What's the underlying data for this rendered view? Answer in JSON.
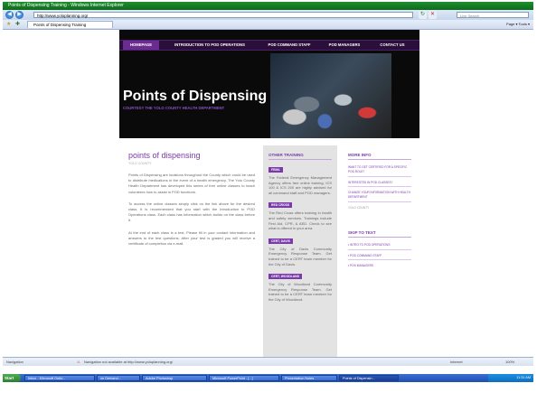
{
  "browser": {
    "title": "Points of Dispensing Training - Windows Internet Explorer",
    "address": "http://www.yoloplanning.org/",
    "search_placeholder": "Live Search",
    "tab_label": "Points of Dispensing Training",
    "toolbar_right": "Page ▾  Tools ▾"
  },
  "site": {
    "nav": [
      "HOMEPAGE",
      "INTRODUCTION TO POD OPERATIONS",
      "POD COMMAND STAFF",
      "POD MANAGERS",
      "CONTACT US"
    ],
    "title": "Points of Dispensing",
    "subtitle": "COURTESY THE YOLO COUNTY HEALTH DEPARTMENT"
  },
  "main": {
    "heading": "points of dispensing",
    "meta": "YOLO COUNTY",
    "paragraphs": [
      "Points of Dispensing are locations throughout the County which could be used to distribute medications in the event of a health emergency. The Yolo County Health Department has developed this series of free online classes to teach volunteers how to assist in POD functions.",
      "To access the online classes simply click on the link above for the desired class. It is recommended that you start with the Introduction to POD Operations class. Each class has information which builds on the class before it.",
      "At the end of each class is a test. Please fill in your contact information and answers to the test questions. After your test is graded you will receive a certificate of completion via e-mail."
    ]
  },
  "other_training": {
    "heading": "OTHER TRAINING",
    "items": [
      {
        "tag": "FEMA",
        "text": "The Federal Emergency Management Agency offers free online training. ICS 100 & ICS 200 are highly advised for all command staff and POD managers."
      },
      {
        "tag": "RED CROSS",
        "text": "The Red Cross offers training in health and safety services. Trainings include First Aid, CPR, & AED. Check to see what is offered in your area."
      },
      {
        "tag": "CERT, DAVIS",
        "text": "The City of Davis Community Emergency Response Team. Get trained to be a CERT team member for the City of Davis."
      },
      {
        "tag": "CERT, WOODLAND",
        "text": "The City of Woodland Community Emergency Response Team. Get trained to be a CERT team member for the City of Woodland."
      }
    ]
  },
  "more_info": {
    "heading": "MORE INFO",
    "items": [
      "WANT TO GET CERTIFIED FOR A SPECIFIC POD ROLE?",
      "INTERESTED IN POD CLASSES?",
      "CHANGE YOUR INFORMATION WITH HEALTH DEPARTMENT",
      "YOLO COUNTY"
    ]
  },
  "skip_to_text": {
    "heading": "SKIP TO TEXT",
    "items": [
      "INTRO TO POD OPERATIONS",
      "POD COMMAND STAFF",
      "POD MANAGERS"
    ]
  },
  "status": {
    "left": "Navigation",
    "message": "Navigation not available at http://www.yoloplanning.org/",
    "zone": "Internet",
    "zoom": "100%"
  },
  "taskbar": {
    "start": "Start",
    "buttons": [
      "Inbox - Microsoft Outlo...",
      "on Demand...",
      "Adobe Photoshop",
      "Microsoft PowerPoint - [...]",
      "Presentation Notes",
      "Points of Dispensin..."
    ],
    "clock": "11:31 AM"
  }
}
